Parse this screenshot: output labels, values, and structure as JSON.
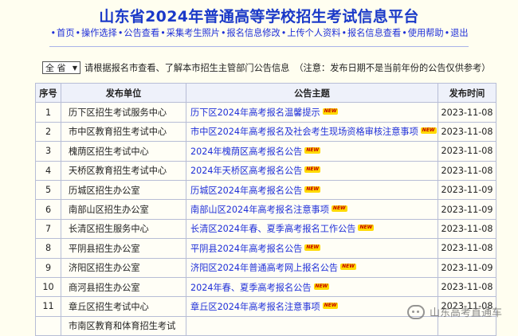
{
  "header": {
    "title": "山东省2024年普通高等学校招生考试信息平台"
  },
  "nav": {
    "items": [
      "首页",
      "操作选择",
      "公告查看",
      "采集考生照片",
      "报名信息修改",
      "上传个人资料",
      "报名信息查看",
      "使用帮助",
      "退出"
    ]
  },
  "filter": {
    "selected": "全 省",
    "hint": "请根据报名市查看、了解本市招生主管部门公告信息",
    "note": "（注意：发布日期不是当前年份的公告仅供参考）"
  },
  "table": {
    "headers": [
      "序号",
      "发布单位",
      "公告主题",
      "发布时间"
    ],
    "rows": [
      {
        "no": "1",
        "unit": "历下区招生考试服务中心",
        "topic": "历下区2024年高考报名温馨提示",
        "date": "2023-11-08"
      },
      {
        "no": "2",
        "unit": "市中区教育招生考试中心",
        "topic": "市中区2024年高考报名及社会考生现场资格审核注意事项",
        "date": "2023-11-08"
      },
      {
        "no": "3",
        "unit": "槐荫区招生考试中心",
        "topic": "2024年槐荫区高考报名公告",
        "date": "2023-11-08"
      },
      {
        "no": "4",
        "unit": "天桥区教育招生考试中心",
        "topic": "2024年天桥区高考报名公告",
        "date": "2023-11-08"
      },
      {
        "no": "5",
        "unit": "历城区招生办公室",
        "topic": "历城区2024年高考报名公告",
        "date": "2023-11-09"
      },
      {
        "no": "6",
        "unit": "南部山区招生办公室",
        "topic": "南部山区2024年高考报名注意事项",
        "date": "2023-11-09"
      },
      {
        "no": "7",
        "unit": "长清区招生服务中心",
        "topic": "长清区2024年春、夏季高考报名工作公告",
        "date": "2023-11-08"
      },
      {
        "no": "8",
        "unit": "平阴县招生办公室",
        "topic": "平阴县2024年高考报名公告",
        "date": "2023-11-08"
      },
      {
        "no": "9",
        "unit": "济阳区招生办公室",
        "topic": "济阳区2024年普通高考网上报名公告",
        "date": "2023-11-09"
      },
      {
        "no": "10",
        "unit": "商河县招生办公室",
        "topic": "2024年春、夏季高考报名公告",
        "date": "2023-11-08"
      },
      {
        "no": "11",
        "unit": "章丘区招生考试中心",
        "topic": "章丘区2024年高考报名注意事项",
        "date": "2023-11-08"
      },
      {
        "no": "",
        "unit": "市南区教育和体育招生考试",
        "topic": "",
        "date": ""
      }
    ]
  },
  "badge": {
    "new_label": "NEW"
  },
  "watermark": {
    "text": "山东高考直通车",
    "icon": "wechat-icon"
  },
  "colors": {
    "title": "#1a39c8",
    "link": "#1f2fd8",
    "background": "#fffef0"
  }
}
